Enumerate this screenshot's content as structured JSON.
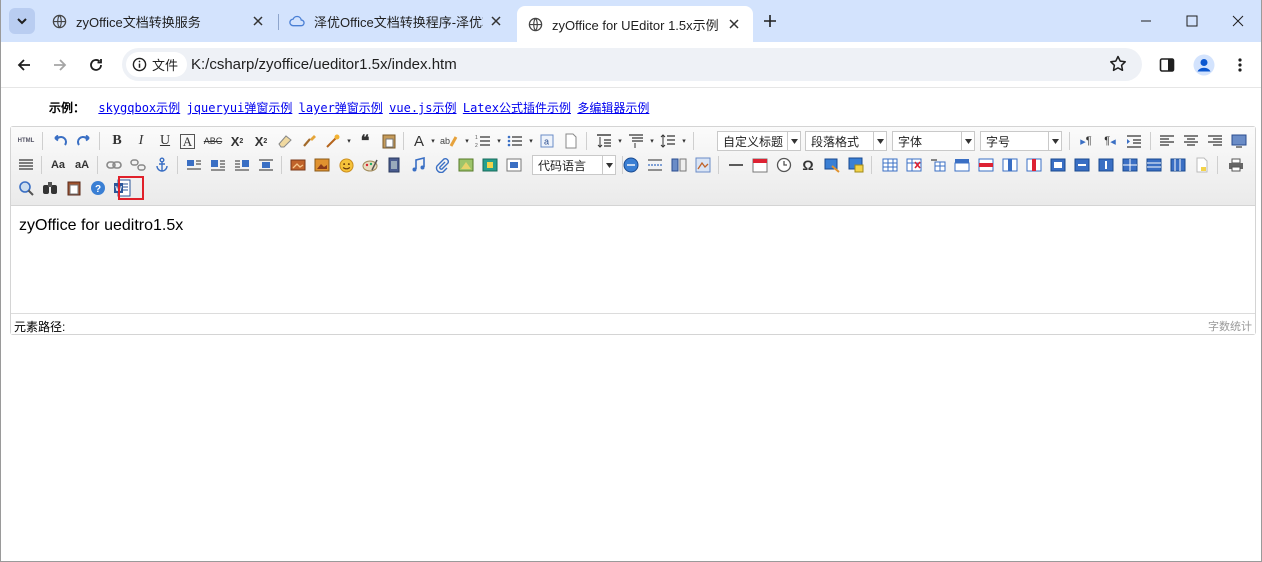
{
  "tabs": [
    {
      "title": "zyOffice文档转换服务",
      "icon": "globe-icon",
      "active": false
    },
    {
      "title": "泽优Office文档转换程序-泽优软件",
      "icon": "cloud-icon",
      "active": false
    },
    {
      "title": "zyOffice for UEditor 1.5x示例",
      "icon": "globe-icon",
      "active": true
    }
  ],
  "address": {
    "security_label": "文件",
    "url": "K:/csharp/zyoffice/ueditor1.5x/index.htm"
  },
  "examples": {
    "label": "示例：",
    "links": [
      "skygqbox示例",
      "jqueryui弹窗示例",
      "layer弹窗示例",
      "vue.js示例",
      "Latex公式插件示例",
      "多编辑器示例"
    ]
  },
  "editor": {
    "dropdowns": {
      "heading": "自定义标题",
      "paragraph": "段落格式",
      "font": "字体",
      "size": "字号",
      "code_language": "代码语言"
    },
    "content_text": "zyOffice for ueditro1.5x",
    "path_label": "元素路径:",
    "word_count_label": "字数统计"
  },
  "colors": {
    "tabstrip": "#d3e3fd",
    "highlight": "#e0202a",
    "link": "#0000ee"
  }
}
